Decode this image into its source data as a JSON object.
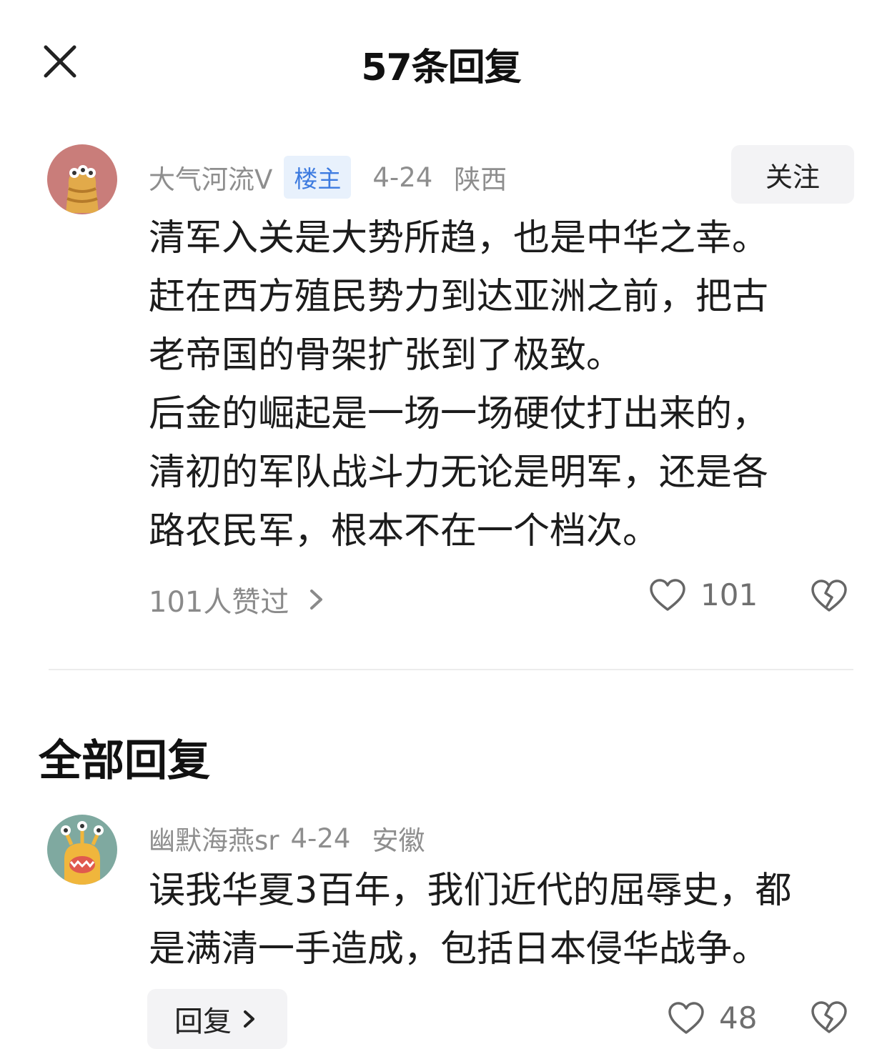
{
  "header": {
    "title": "57条回复",
    "close_icon": "close-icon"
  },
  "main_comment": {
    "username": "大气河流V",
    "badge": "楼主",
    "date": "4-24",
    "location": "陕西",
    "follow_label": "关注",
    "paragraphs": [
      "清军入关是大势所趋，也是中华之幸。",
      "赶在西方殖民势力到达亚洲之前，把古",
      "老帝国的骨架扩张到了极致。",
      "后金的崛起是一场一场硬仗打出来的，",
      "清初的军队战斗力无论是明军，还是各",
      "路农民军，根本不在一个档次。"
    ],
    "likes_summary": "101人赞过",
    "like_count": "101"
  },
  "section": {
    "title": "全部回复"
  },
  "replies": [
    {
      "username": "幽默海燕sr",
      "date": "4-24",
      "location": "安徽",
      "paragraphs": [
        "误我华夏3百年，我们近代的屈辱史，都",
        "是满清一手造成，包括日本侵华战争。"
      ],
      "reply_label": "回复",
      "like_count": "48"
    }
  ],
  "colors": {
    "badge_bg": "#e8f1fc",
    "badge_text": "#3d7be0",
    "meta_text": "#8e8e8e",
    "avatar1_bg": "#c97d7a",
    "avatar2_bg": "#7fa9a0"
  }
}
